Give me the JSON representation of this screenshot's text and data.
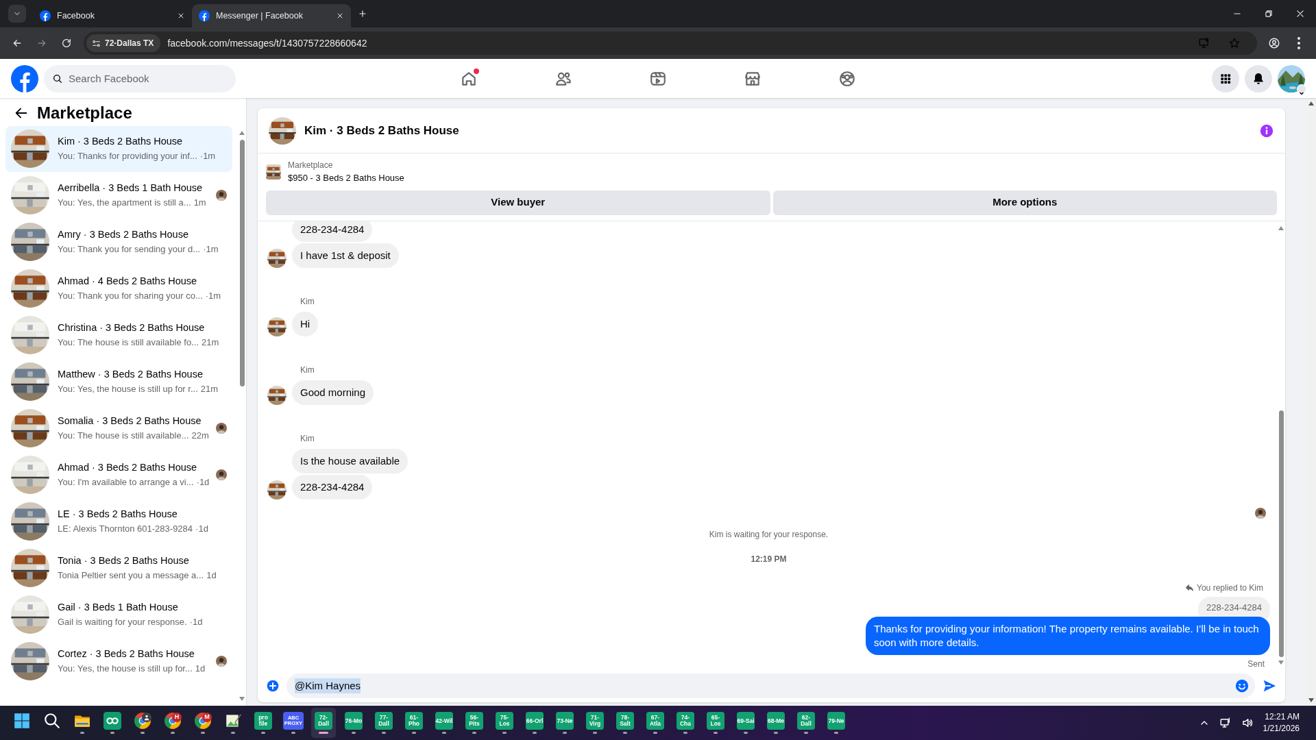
{
  "browser": {
    "tabs": [
      {
        "title": "Facebook",
        "selected": false
      },
      {
        "title": "Messenger | Facebook",
        "selected": true
      }
    ],
    "site_chip": "72-Dallas TX",
    "url": "facebook.com/messages/t/1430757228660642"
  },
  "facebook_nav": {
    "search": {
      "placeholder": "Search Facebook"
    },
    "nav_items": [
      {
        "kind": "home",
        "notification": true
      },
      {
        "kind": "friends",
        "notification": false
      },
      {
        "kind": "video",
        "notification": false
      },
      {
        "kind": "marketplace",
        "notification": false
      },
      {
        "kind": "groups",
        "notification": false
      }
    ]
  },
  "sidebar": {
    "title": "Marketplace",
    "conversations": [
      {
        "title": "Kim · 3 Beds 2 Baths House",
        "preview": "You: Thanks for providing your inf...",
        "time": "·1m",
        "selected": true,
        "seen_avatar": false
      },
      {
        "title": "Aerribella · 3 Beds 1 Bath House",
        "preview": "You: Yes, the apartment is still a...",
        "time": "1m",
        "selected": false,
        "seen_avatar": true
      },
      {
        "title": "Amry · 3 Beds 2 Baths House",
        "preview": "You: Thank you for sending your d...",
        "time": "·1m",
        "selected": false,
        "seen_avatar": false
      },
      {
        "title": "Ahmad · 4 Beds 2 Baths House",
        "preview": "You: Thank you for sharing your co...",
        "time": "·1m",
        "selected": false,
        "seen_avatar": false
      },
      {
        "title": "Christina · 3 Beds 2 Baths House",
        "preview": "You: The house is still available fo...",
        "time": "21m",
        "selected": false,
        "seen_avatar": false
      },
      {
        "title": "Matthew · 3 Beds 2 Baths House",
        "preview": "You: Yes, the house is still up for r...",
        "time": "21m",
        "selected": false,
        "seen_avatar": false
      },
      {
        "title": "Somalia · 3 Beds 2 Baths House",
        "preview": "You: The house is still available...",
        "time": "22m",
        "selected": false,
        "seen_avatar": true
      },
      {
        "title": "Ahmad · 3 Beds 2 Baths House",
        "preview": "You: I'm available to arrange a vi...",
        "time": "·1d",
        "selected": false,
        "seen_avatar": true
      },
      {
        "title": "LE · 3 Beds 2 Baths House",
        "preview": "LE: Alexis Thornton 601-283-9284",
        "time": "·1d",
        "selected": false,
        "seen_avatar": false
      },
      {
        "title": "Tonia · 3 Beds 2 Baths House",
        "preview": "Tonia Peltier sent you a message a...",
        "time": "1d",
        "selected": false,
        "seen_avatar": false
      },
      {
        "title": "Gail · 3 Beds 1 Bath House",
        "preview": "Gail is waiting for your response.",
        "time": "·1d",
        "selected": false,
        "seen_avatar": false
      },
      {
        "title": "Cortez · 3 Beds 2 Baths House",
        "preview": "You: Yes, the house is still up for...",
        "time": "1d",
        "selected": false,
        "seen_avatar": true
      }
    ]
  },
  "chat": {
    "title": "Kim · 3 Beds 2 Baths House",
    "listing": {
      "label": "Marketplace",
      "detail": "$950 - 3 Beds 2 Baths House"
    },
    "buttons": [
      "View buyer",
      "More options"
    ],
    "messages": [
      {
        "kind": "incoming",
        "text": "228-234-4284",
        "avatar": false
      },
      {
        "kind": "incoming",
        "text": "I have 1st & deposit",
        "avatar": true
      },
      {
        "kind": "sender",
        "text": "Kim"
      },
      {
        "kind": "incoming",
        "text": "Hi",
        "avatar": true
      },
      {
        "kind": "sender",
        "text": "Kim"
      },
      {
        "kind": "incoming",
        "text": "Good morning",
        "avatar": true
      },
      {
        "kind": "sender",
        "text": "Kim"
      },
      {
        "kind": "incoming",
        "text": "Is the house available",
        "avatar": false
      },
      {
        "kind": "incoming",
        "text": "228-234-4284",
        "avatar": true
      },
      {
        "kind": "seen"
      },
      {
        "kind": "status",
        "text": "Kim is waiting for your response."
      },
      {
        "kind": "time",
        "text": "12:19 PM"
      },
      {
        "kind": "replied",
        "text": "You replied to Kim"
      },
      {
        "kind": "quote",
        "text": "228-234-4284"
      },
      {
        "kind": "outgoing",
        "text": "Thanks for providing your information! The property remains available. I’ll be in touch soon with more details."
      },
      {
        "kind": "receipt",
        "text": "Sent"
      }
    ],
    "composer": {
      "value": "@Kim Haynes"
    }
  },
  "taskbar": {
    "apps": [
      {
        "kind": "windows"
      },
      {
        "kind": "search"
      },
      {
        "kind": "folder"
      },
      {
        "kind": "loop"
      },
      {
        "kind": "chrome-user"
      },
      {
        "kind": "chrome",
        "badge": "H"
      },
      {
        "kind": "chrome",
        "badge": "M"
      },
      {
        "kind": "paint"
      },
      {
        "kind": "tile",
        "label": "pro file",
        "color": "#12a170",
        "selected": false
      },
      {
        "kind": "tile",
        "label": "ABC PROXY",
        "color": "#4a5ff0",
        "selected": false
      },
      {
        "kind": "tile",
        "label": "72-Dall",
        "color": "#12a170",
        "selected": true
      },
      {
        "kind": "tile",
        "label": "76-Mo",
        "color": "#12a170",
        "selected": false
      },
      {
        "kind": "tile",
        "label": "77-Dall",
        "color": "#12a170",
        "selected": false
      },
      {
        "kind": "tile",
        "label": "61-Pho",
        "color": "#12a170",
        "selected": false
      },
      {
        "kind": "tile",
        "label": "42-Wil",
        "color": "#12a170",
        "selected": false
      },
      {
        "kind": "tile",
        "label": "56-Pits",
        "color": "#12a170",
        "selected": false
      },
      {
        "kind": "tile",
        "label": "75-Los",
        "color": "#12a170",
        "selected": false
      },
      {
        "kind": "tile",
        "label": "66-Orl",
        "color": "#12a170",
        "selected": false
      },
      {
        "kind": "tile",
        "label": "73-Ne",
        "color": "#12a170",
        "selected": false
      },
      {
        "kind": "tile",
        "label": "71-Virg",
        "color": "#12a170",
        "selected": false
      },
      {
        "kind": "tile",
        "label": "78-Salt",
        "color": "#12a170",
        "selected": false
      },
      {
        "kind": "tile",
        "label": "67-Atla",
        "color": "#12a170",
        "selected": false
      },
      {
        "kind": "tile",
        "label": "74-Cha",
        "color": "#12a170",
        "selected": false
      },
      {
        "kind": "tile",
        "label": "65-Los",
        "color": "#12a170",
        "selected": false
      },
      {
        "kind": "tile",
        "label": "69-Sai",
        "color": "#12a170",
        "selected": false
      },
      {
        "kind": "tile",
        "label": "68-Me",
        "color": "#12a170",
        "selected": false
      },
      {
        "kind": "tile",
        "label": "62-Dall",
        "color": "#12a170",
        "selected": false
      },
      {
        "kind": "tile",
        "label": "79-Ne",
        "color": "#12a170",
        "selected": false
      }
    ],
    "clock": {
      "time": "12:21 AM",
      "date": "1/21/2026"
    }
  }
}
